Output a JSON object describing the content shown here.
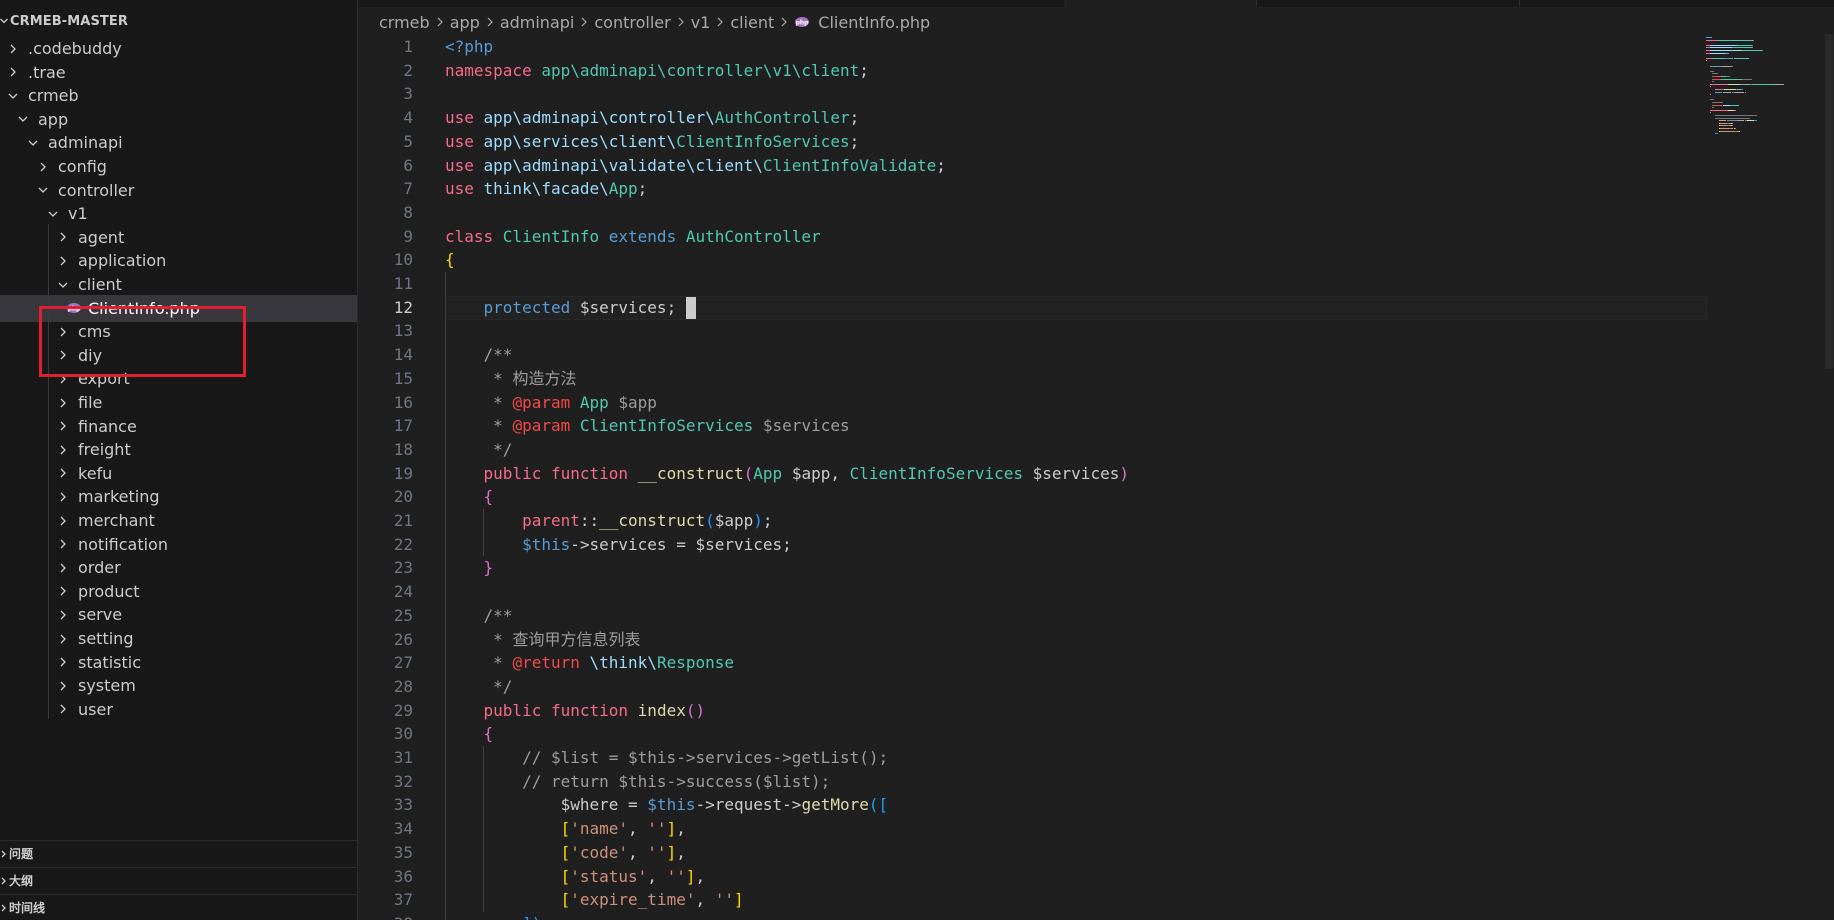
{
  "explorer": {
    "title": "CRMEB-MASTER",
    "tree": [
      {
        "label": ".codebuddy",
        "depth": 0,
        "expanded": false
      },
      {
        "label": ".trae",
        "depth": 0,
        "expanded": false
      },
      {
        "label": "crmeb",
        "depth": 0,
        "expanded": true
      },
      {
        "label": "app",
        "depth": 1,
        "expanded": true
      },
      {
        "label": "adminapi",
        "depth": 2,
        "expanded": true
      },
      {
        "label": "config",
        "depth": 3,
        "expanded": false
      },
      {
        "label": "controller",
        "depth": 3,
        "expanded": true
      },
      {
        "label": "v1",
        "depth": 4,
        "expanded": true
      },
      {
        "label": "agent",
        "depth": 5,
        "expanded": false
      },
      {
        "label": "application",
        "depth": 5,
        "expanded": false
      },
      {
        "label": "client",
        "depth": 5,
        "expanded": true
      },
      {
        "label": "ClientInfo.php",
        "depth": 6,
        "file": true,
        "selected": true
      },
      {
        "label": "cms",
        "depth": 5,
        "expanded": false
      },
      {
        "label": "diy",
        "depth": 5,
        "expanded": false
      },
      {
        "label": "export",
        "depth": 5,
        "expanded": false
      },
      {
        "label": "file",
        "depth": 5,
        "expanded": false
      },
      {
        "label": "finance",
        "depth": 5,
        "expanded": false
      },
      {
        "label": "freight",
        "depth": 5,
        "expanded": false
      },
      {
        "label": "kefu",
        "depth": 5,
        "expanded": false
      },
      {
        "label": "marketing",
        "depth": 5,
        "expanded": false
      },
      {
        "label": "merchant",
        "depth": 5,
        "expanded": false
      },
      {
        "label": "notification",
        "depth": 5,
        "expanded": false
      },
      {
        "label": "order",
        "depth": 5,
        "expanded": false
      },
      {
        "label": "product",
        "depth": 5,
        "expanded": false
      },
      {
        "label": "serve",
        "depth": 5,
        "expanded": false
      },
      {
        "label": "setting",
        "depth": 5,
        "expanded": false
      },
      {
        "label": "statistic",
        "depth": 5,
        "expanded": false
      },
      {
        "label": "system",
        "depth": 5,
        "expanded": false
      },
      {
        "label": "user",
        "depth": 5,
        "expanded": false
      }
    ],
    "panels": [
      "问题",
      "大纲",
      "时间线"
    ]
  },
  "breadcrumb": {
    "parts": [
      "crmeb",
      "app",
      "adminapi",
      "controller",
      "v1",
      "client"
    ],
    "file": "ClientInfo.php"
  },
  "editor": {
    "current_line": 12,
    "lines": [
      [
        [
          "ptag",
          "<?php"
        ]
      ],
      [
        [
          "kw",
          "namespace "
        ],
        [
          "ns",
          "app\\adminapi\\controller\\v1\\client"
        ],
        [
          "punct",
          ";"
        ]
      ],
      [],
      [
        [
          "kw",
          "use "
        ],
        [
          "path",
          "app\\adminapi\\controller\\"
        ],
        [
          "cls",
          "AuthController"
        ],
        [
          "punct",
          ";"
        ]
      ],
      [
        [
          "kw",
          "use "
        ],
        [
          "path",
          "app\\services\\client\\"
        ],
        [
          "cls",
          "ClientInfoServices"
        ],
        [
          "punct",
          ";"
        ]
      ],
      [
        [
          "kw",
          "use "
        ],
        [
          "path",
          "app\\adminapi\\validate\\client\\"
        ],
        [
          "cls",
          "ClientInfoValidate"
        ],
        [
          "punct",
          ";"
        ]
      ],
      [
        [
          "kw",
          "use "
        ],
        [
          "path",
          "think\\facade\\"
        ],
        [
          "cls",
          "App"
        ],
        [
          "punct",
          ";"
        ]
      ],
      [],
      [
        [
          "kw",
          "class "
        ],
        [
          "cls",
          "ClientInfo "
        ],
        [
          "kw2",
          "extends "
        ],
        [
          "cls",
          "AuthController"
        ]
      ],
      [
        [
          "brace",
          "{"
        ]
      ],
      [],
      [
        [
          "punct",
          "    "
        ],
        [
          "kw2",
          "protected "
        ],
        [
          "var",
          "$services"
        ],
        [
          "punct",
          "; "
        ]
      ],
      [],
      [
        [
          "punct",
          "    "
        ],
        [
          "cmt",
          "/**"
        ]
      ],
      [
        [
          "punct",
          "     "
        ],
        [
          "cmt",
          "* 构造方法"
        ]
      ],
      [
        [
          "punct",
          "     "
        ],
        [
          "cmt",
          "* "
        ],
        [
          "tag",
          "@param "
        ],
        [
          "cls",
          "App "
        ],
        [
          "cmt",
          "$app"
        ]
      ],
      [
        [
          "punct",
          "     "
        ],
        [
          "cmt",
          "* "
        ],
        [
          "tag",
          "@param "
        ],
        [
          "cls",
          "ClientInfoServices "
        ],
        [
          "cmt",
          "$services"
        ]
      ],
      [
        [
          "punct",
          "     "
        ],
        [
          "cmt",
          "*/"
        ]
      ],
      [
        [
          "punct",
          "    "
        ],
        [
          "kw",
          "public "
        ],
        [
          "kw",
          "function "
        ],
        [
          "fn",
          "__construct"
        ],
        [
          "brace2",
          "("
        ],
        [
          "cls",
          "App "
        ],
        [
          "var",
          "$app"
        ],
        [
          "punct",
          ", "
        ],
        [
          "cls",
          "ClientInfoServices "
        ],
        [
          "var",
          "$services"
        ],
        [
          "brace2",
          ")"
        ]
      ],
      [
        [
          "punct",
          "    "
        ],
        [
          "brace2",
          "{"
        ]
      ],
      [
        [
          "punct",
          "        "
        ],
        [
          "kw",
          "parent"
        ],
        [
          "punct",
          "::"
        ],
        [
          "fn",
          "__construct"
        ],
        [
          "brace3",
          "("
        ],
        [
          "var",
          "$app"
        ],
        [
          "brace3",
          ")"
        ],
        [
          "punct",
          ";"
        ]
      ],
      [
        [
          "punct",
          "        "
        ],
        [
          "this",
          "$this"
        ],
        [
          "punct",
          "->"
        ],
        [
          "var",
          "services"
        ],
        [
          "punct",
          " = "
        ],
        [
          "var",
          "$services"
        ],
        [
          "punct",
          ";"
        ]
      ],
      [
        [
          "punct",
          "    "
        ],
        [
          "brace2",
          "}"
        ]
      ],
      [],
      [
        [
          "punct",
          "    "
        ],
        [
          "cmt",
          "/**"
        ]
      ],
      [
        [
          "punct",
          "     "
        ],
        [
          "cmt",
          "* 查询甲方信息列表"
        ]
      ],
      [
        [
          "punct",
          "     "
        ],
        [
          "cmt",
          "* "
        ],
        [
          "tag",
          "@return "
        ],
        [
          "path",
          "\\think\\"
        ],
        [
          "cls",
          "Response"
        ]
      ],
      [
        [
          "punct",
          "     "
        ],
        [
          "cmt",
          "*/"
        ]
      ],
      [
        [
          "punct",
          "    "
        ],
        [
          "kw",
          "public "
        ],
        [
          "kw",
          "function "
        ],
        [
          "fn",
          "index"
        ],
        [
          "brace2",
          "()"
        ]
      ],
      [
        [
          "punct",
          "    "
        ],
        [
          "brace2",
          "{"
        ]
      ],
      [
        [
          "punct",
          "        "
        ],
        [
          "cmt",
          "// $list = $this->services->getList();"
        ]
      ],
      [
        [
          "punct",
          "        "
        ],
        [
          "cmt",
          "// return $this->success($list);"
        ]
      ],
      [
        [
          "punct",
          "            "
        ],
        [
          "var",
          "$where"
        ],
        [
          "punct",
          " = "
        ],
        [
          "this",
          "$this"
        ],
        [
          "punct",
          "->"
        ],
        [
          "var",
          "request"
        ],
        [
          "punct",
          "->"
        ],
        [
          "fn",
          "getMore"
        ],
        [
          "brace3",
          "(["
        ]
      ],
      [
        [
          "punct",
          "            "
        ],
        [
          "brace",
          "["
        ],
        [
          "str",
          "'name'"
        ],
        [
          "punct",
          ", "
        ],
        [
          "str",
          "''"
        ],
        [
          "brace",
          "]"
        ],
        [
          "punct",
          ","
        ]
      ],
      [
        [
          "punct",
          "            "
        ],
        [
          "brace",
          "["
        ],
        [
          "str",
          "'code'"
        ],
        [
          "punct",
          ", "
        ],
        [
          "str",
          "''"
        ],
        [
          "brace",
          "]"
        ],
        [
          "punct",
          ","
        ]
      ],
      [
        [
          "punct",
          "            "
        ],
        [
          "brace",
          "["
        ],
        [
          "str",
          "'status'"
        ],
        [
          "punct",
          ", "
        ],
        [
          "str",
          "''"
        ],
        [
          "brace",
          "]"
        ],
        [
          "punct",
          ","
        ]
      ],
      [
        [
          "punct",
          "            "
        ],
        [
          "brace",
          "["
        ],
        [
          "str",
          "'expire_time'"
        ],
        [
          "punct",
          ", "
        ],
        [
          "str",
          "''"
        ],
        [
          "brace",
          "]"
        ]
      ],
      [
        [
          "punct",
          "        "
        ],
        [
          "brace3",
          "]);"
        ]
      ]
    ]
  },
  "colors": {
    "selection_box": "#e0202f",
    "background": "#1f1f1f",
    "sidebar": "#181818",
    "php_icon": "#a074c4"
  }
}
